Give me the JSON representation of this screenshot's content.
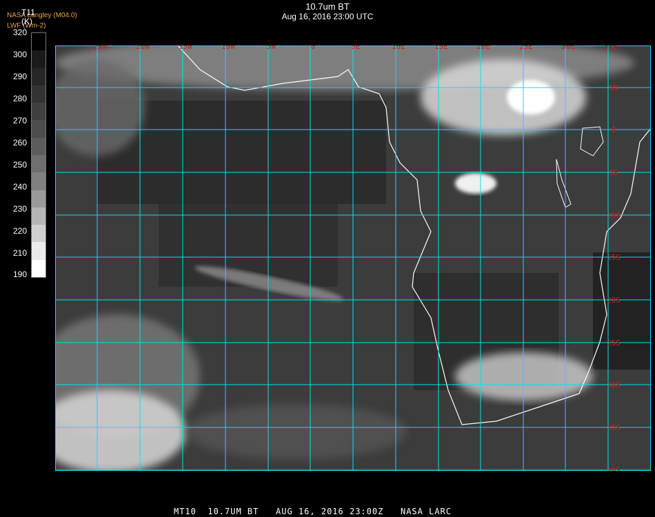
{
  "header": {
    "title": "10.7um BT",
    "subtitle": "Aug 16, 2016 23:00 UTC",
    "credit_line1": "NASA Langley (M04.0)",
    "credit_line2": "LWF (Wm-2)"
  },
  "colorbar": {
    "label_line1": "T11",
    "label_line2": "(K)",
    "ticks": [
      "320",
      "300",
      "290",
      "280",
      "270",
      "260",
      "250",
      "240",
      "230",
      "220",
      "210",
      "190"
    ],
    "colors": [
      "#000000",
      "#1a1a1a",
      "#262626",
      "#333333",
      "#404040",
      "#4d4d4d",
      "#5c5c5c",
      "#6e6e6e",
      "#808080",
      "#9a9a9a",
      "#b5b5b5",
      "#d0d0d0",
      "#ebebeb",
      "#ffffff"
    ]
  },
  "map": {
    "grid_color": "#00e5ee",
    "coast_color": "#ffffff",
    "lon_labels": [
      "25W",
      "20W",
      "15W",
      "10W",
      "5W",
      "0",
      "5E",
      "10E",
      "15E",
      "20E",
      "25E",
      "30E",
      "35E"
    ],
    "lat_labels": [
      "5N",
      "0",
      "5S",
      "10S",
      "15S",
      "20S",
      "25S",
      "30S",
      "35S",
      "40S"
    ],
    "label_color": "#cc2020"
  },
  "footer": {
    "text": "MT10  10.7UM BT   AUG 16, 2016 23:00Z   NASA LARC"
  }
}
